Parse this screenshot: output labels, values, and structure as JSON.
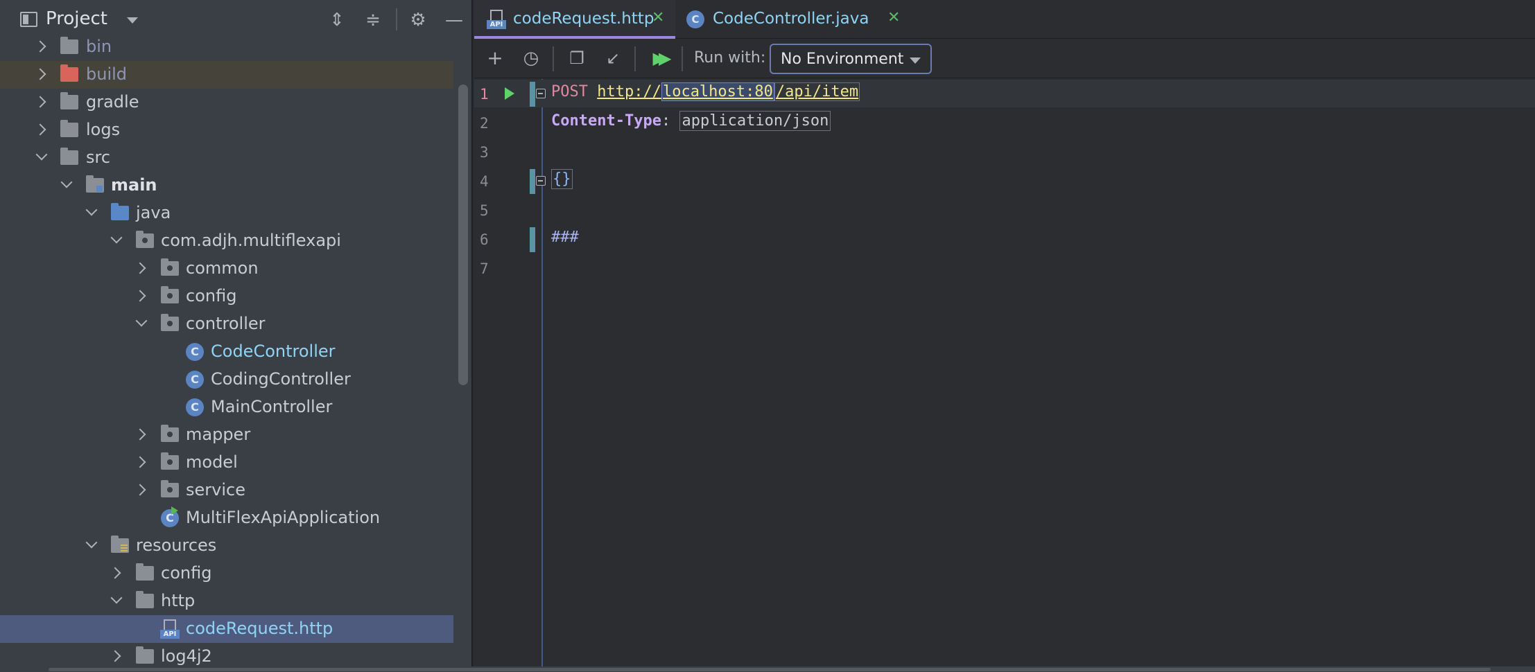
{
  "project_panel": {
    "title": "Project",
    "header_icons": [
      "expand-all-icon",
      "collapse-all-icon",
      "gear-icon",
      "minimize-icon"
    ],
    "tree": [
      {
        "label": "bin",
        "kind": "folder",
        "style": "dim",
        "expanded": false
      },
      {
        "label": "build",
        "kind": "folder-red",
        "style": "dim",
        "expanded": false
      },
      {
        "label": "gradle",
        "kind": "folder",
        "expanded": false
      },
      {
        "label": "logs",
        "kind": "folder",
        "expanded": false
      },
      {
        "label": "src",
        "kind": "folder",
        "expanded": true
      },
      {
        "label": "main",
        "kind": "folder-source",
        "style": "bold",
        "expanded": true
      },
      {
        "label": "java",
        "kind": "folder-blue",
        "expanded": true
      },
      {
        "label": "com.adjh.multiflexapi",
        "kind": "package",
        "expanded": true
      },
      {
        "label": "common",
        "kind": "package",
        "expanded": false
      },
      {
        "label": "config",
        "kind": "package",
        "expanded": false
      },
      {
        "label": "controller",
        "kind": "package",
        "expanded": true
      },
      {
        "label": "CodeController",
        "kind": "class",
        "style": "cyan"
      },
      {
        "label": "CodingController",
        "kind": "class"
      },
      {
        "label": "MainController",
        "kind": "class"
      },
      {
        "label": "mapper",
        "kind": "package",
        "expanded": false
      },
      {
        "label": "model",
        "kind": "package",
        "expanded": false
      },
      {
        "label": "service",
        "kind": "package",
        "expanded": false
      },
      {
        "label": "MultiFlexApiApplication",
        "kind": "app-class"
      },
      {
        "label": "resources",
        "kind": "folder-resources",
        "expanded": true
      },
      {
        "label": "config",
        "kind": "folder",
        "expanded": false
      },
      {
        "label": "http",
        "kind": "folder",
        "expanded": true
      },
      {
        "label": "codeRequest.http",
        "kind": "http-file",
        "style": "cyan",
        "selected": true
      },
      {
        "label": "log4j2",
        "kind": "folder",
        "expanded": false
      }
    ]
  },
  "tabs": [
    {
      "label": "codeRequest.http",
      "icon": "api-file-icon",
      "active": true
    },
    {
      "label": "CodeController.java",
      "icon": "class-c-icon",
      "active": false
    }
  ],
  "toolbar": {
    "icons": [
      "add-icon",
      "history-icon",
      "copy-icon",
      "import-icon",
      "run-all-icon"
    ],
    "run_with_label": "Run with:",
    "environment": "No Environment"
  },
  "editor": {
    "line_numbers": [
      "1",
      "2",
      "3",
      "4",
      "5",
      "6",
      "7"
    ],
    "method": "POST",
    "url_scheme": "http://",
    "url_host": "localhost:80",
    "url_path": "/api/item",
    "header_name": "Content-Type",
    "header_colon": ": ",
    "header_value": "application/json",
    "body": "{}",
    "separator": "###"
  },
  "colors": {
    "selection_bg": "#4f5b7e",
    "accent_tab": "#9d86e0",
    "post_keyword": "#e08aa0",
    "url": "#f2e68b",
    "header_name": "#c9a8f7"
  }
}
